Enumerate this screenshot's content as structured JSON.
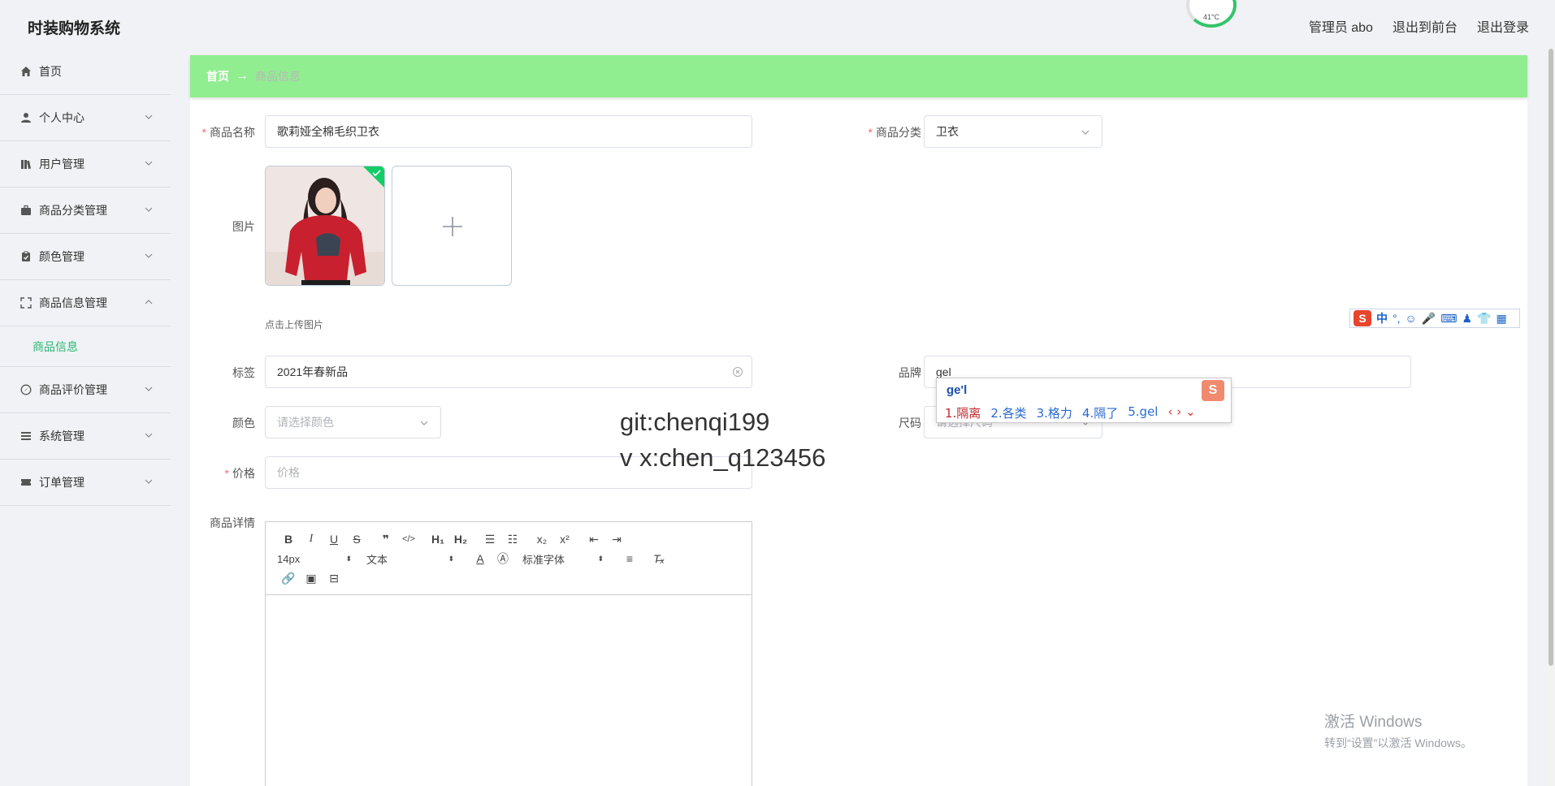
{
  "header": {
    "app_title": "时装购物系统",
    "gauge_temp": "41°C",
    "links": [
      "管理员 abo",
      "退出到前台",
      "退出登录"
    ]
  },
  "sidebar": {
    "items": [
      {
        "label": "首页",
        "icon": "home-icon"
      },
      {
        "label": "个人中心",
        "icon": "user-icon"
      },
      {
        "label": "用户管理",
        "icon": "users-icon"
      },
      {
        "label": "商品分类管理",
        "icon": "briefcase-icon"
      },
      {
        "label": "颜色管理",
        "icon": "clipboard-icon"
      },
      {
        "label": "商品信息管理",
        "icon": "fullscreen-icon"
      },
      {
        "label": "商品评价管理",
        "icon": "compass-icon"
      },
      {
        "label": "系统管理",
        "icon": "menu-icon"
      },
      {
        "label": "订单管理",
        "icon": "ticket-icon"
      }
    ],
    "subitem": "商品信息"
  },
  "breadcrumb": {
    "home": "首页",
    "arrow": "→",
    "current": "商品信息"
  },
  "form": {
    "name_label": "商品名称",
    "name_value": "歌莉娅全棉毛织卫衣",
    "category_label": "商品分类",
    "category_value": "卫衣",
    "image_label": "图片",
    "upload_hint": "点击上传图片",
    "tag_label": "标签",
    "tag_value": "2021年春新品",
    "brand_label": "品牌",
    "brand_value": "gel",
    "color_label": "颜色",
    "color_placeholder": "请选择颜色",
    "size_label": "尺码",
    "size_placeholder": "请选择尺码",
    "price_label": "价格",
    "price_placeholder": "价格",
    "detail_label": "商品详情"
  },
  "editor": {
    "font_size": "14px",
    "text_type": "文本",
    "font_family": "标准字体"
  },
  "watermark": {
    "line1": "git:chenqi199",
    "line2": "v x:chen_q123456"
  },
  "ime": {
    "bar_label": "中",
    "input": "ge'l",
    "candidates": [
      "1.隔离",
      "2.各类",
      "3.格力",
      "4.隔了",
      "5.gel"
    ]
  },
  "windows": {
    "line1": "激活 Windows",
    "line2": "转到“设置”以激活 Windows。"
  },
  "colors": {
    "accent": "#2bb673",
    "breadcrumb_bg": "#90ee90",
    "required": "#f56c6c"
  }
}
